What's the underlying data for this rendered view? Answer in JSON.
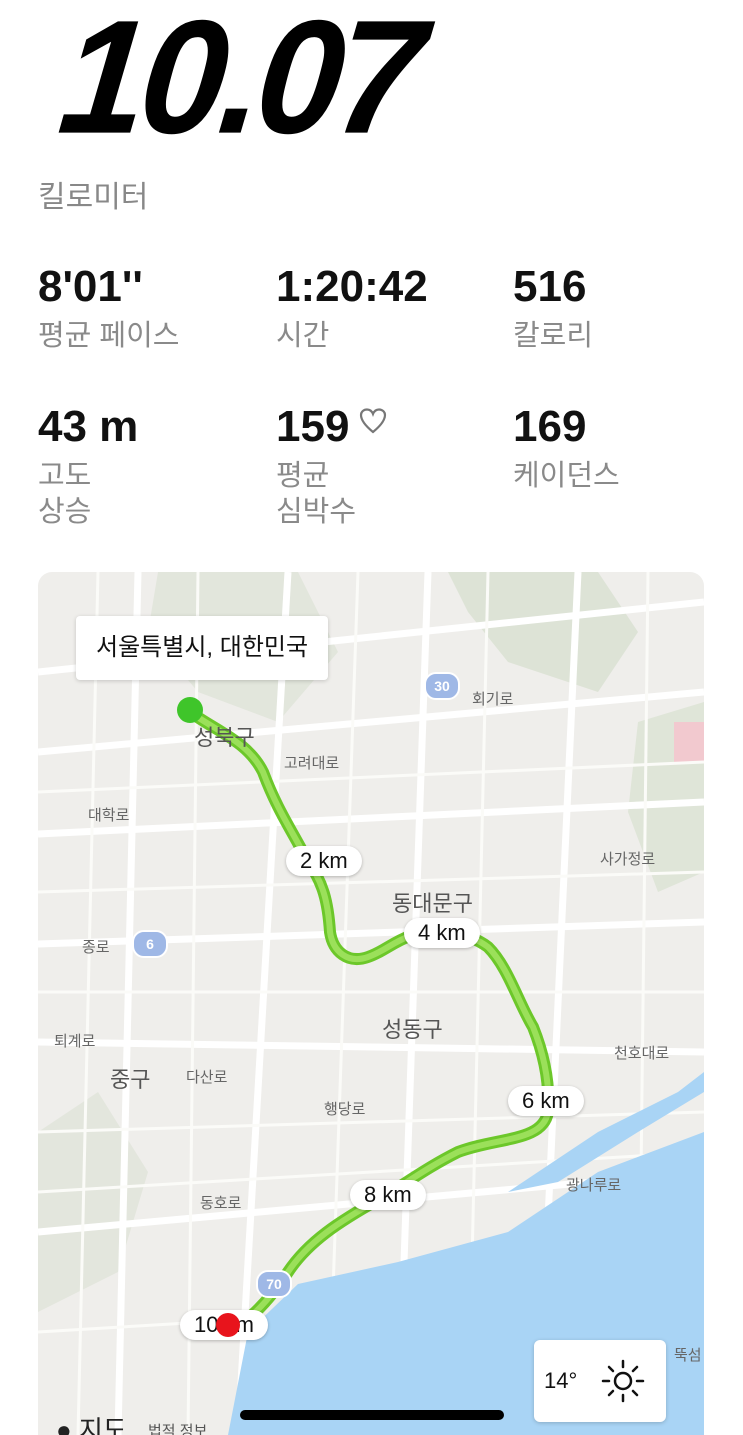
{
  "summary": {
    "distance": "10.07",
    "unit": "킬로미터"
  },
  "stats": [
    {
      "value": "8'01''",
      "label": "평균 페이스"
    },
    {
      "value": "1:20:42",
      "label": "시간"
    },
    {
      "value": "516",
      "label": "칼로리"
    },
    {
      "value": "43 m",
      "label": "고도\n상승"
    },
    {
      "value": "159",
      "label": "평균\n심박수",
      "icon": "heart-icon"
    },
    {
      "value": "169",
      "label": "케이던스"
    }
  ],
  "map": {
    "location": "서울특별시, 대한민국",
    "markers": [
      "2 km",
      "4 km",
      "6 km",
      "8 km",
      "10 km"
    ],
    "districts": [
      "성북구",
      "동대문구",
      "성동구",
      "중구"
    ],
    "roads": [
      "회기로",
      "고려대로",
      "사가정로",
      "천호대로",
      "퇴계로",
      "행당로",
      "광나루로",
      "종로",
      "다산로",
      "대학로",
      "동호로",
      "뚝섬"
    ],
    "route_shields": [
      "30",
      "6",
      "70"
    ],
    "weather": {
      "temp": "14°",
      "icon": "sun-icon"
    },
    "attribution": "지도",
    "legal": "법적 정보"
  },
  "colors": {
    "route": "#7ad12f",
    "start": "#3fc52a",
    "end": "#e8141c",
    "water": "#a9d4f5"
  }
}
